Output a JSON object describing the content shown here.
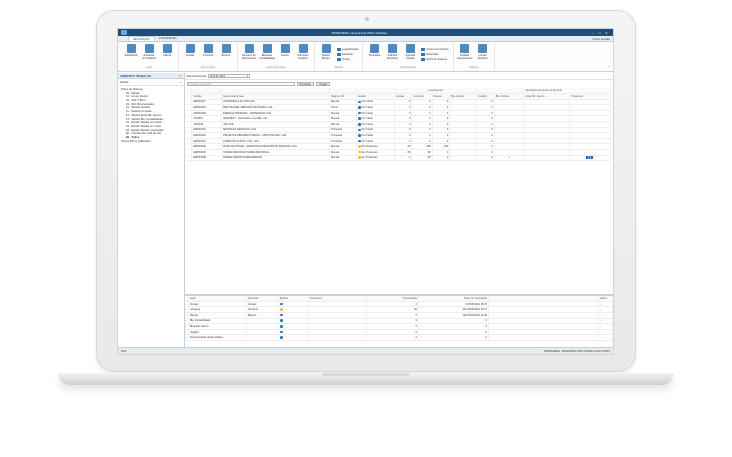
{
  "window": {
    "title": "PRIMAVERA | Accounting Office Software",
    "minimize": "–",
    "maximize": "□",
    "close": "✕"
  },
  "ribbon_tabs": [
    {
      "label": "APLICAÇÃO",
      "active": true
    },
    {
      "label": "CONVERTER",
      "active": false
    }
  ],
  "ribbon_right_link": "Iniciar Sessão",
  "ribbon": {
    "groups": [
      {
        "label": "Início",
        "buttons": [
          {
            "label": "Dashboard",
            "icon": "dashboard-icon",
            "color": "#2e75b6"
          },
          {
            "label": "Ambiente de Trabalho",
            "icon": "workspace-icon",
            "color": "#2e75b6"
          },
          {
            "label": "Cliente",
            "icon": "client-icon",
            "color": "#2e75b6"
          }
        ]
      },
      {
        "label": "Intervenções",
        "buttons": [
          {
            "label": "Vendas",
            "icon": "sales-icon",
            "color": "#2e75b6"
          },
          {
            "label": "Compras",
            "icon": "purchases-icon",
            "color": "#2e75b6"
          },
          {
            "label": "Bancos",
            "icon": "banks-icon",
            "color": "#2e75b6"
          }
        ]
      },
      {
        "label": "Outras Operações",
        "buttons": [
          {
            "label": "Resumo de Documentos",
            "icon": "document-icon",
            "color": "#2e75b6"
          },
          {
            "label": "Bloquear Contabilidade",
            "icon": "lock-icon",
            "color": "#2e75b6"
          },
          {
            "label": "Jasmin",
            "icon": "jasmin-icon",
            "color": "#2e75b6"
          },
          {
            "label": "Submeter Pedidos",
            "icon": "submit-icon",
            "color": "#2e75b6"
          }
        ]
      },
      {
        "label": "Tabelas",
        "buttons": [
          {
            "label": "Dados Mestre",
            "icon": "master-data-icon",
            "color": "#2e75b6"
          }
        ],
        "small": [
          "Legais/Fiscais",
          "Escritório",
          "Outras"
        ]
      },
      {
        "label": "Configurações",
        "buttons": [
          {
            "label": "Templates",
            "icon": "templates-icon",
            "color": "#2e75b6"
          },
          {
            "label": "Padrões Escritório",
            "icon": "defaults-icon",
            "color": "#2e75b6"
          },
          {
            "label": "Agendar Tarefas",
            "icon": "schedule-icon",
            "color": "#2e75b6"
          }
        ],
        "small": [
          "Grupos de Clientes",
          "Extensões",
          "Perfis do Sistema"
        ]
      },
      {
        "label": "Sistema",
        "buttons": [
          {
            "label": "Analisar Lançamentos",
            "icon": "analyze-icon",
            "color": "#2e75b6"
          },
          {
            "label": "Limpar Histórico",
            "icon": "clear-history-icon",
            "color": "#2e75b6"
          }
        ]
      }
    ],
    "collapse": "^"
  },
  "sidebar": {
    "header": "AMBIENTE TRABALHO",
    "close": "✕",
    "subheader": "Pastas",
    "sub_close": "«",
    "items": [
      {
        "label": "Filtros de Sistema",
        "root": true,
        "bold": false
      },
      {
        "label": "00 - Alertas",
        "root": false,
        "bold": false
      },
      {
        "label": "01 - Grupo Jasmin",
        "root": false,
        "bold": false
      },
      {
        "label": "02 - SAF-T Bom",
        "root": false,
        "bold": false
      },
      {
        "label": "03 - IRC Movimentados",
        "root": false,
        "bold": false
      },
      {
        "label": "10 - Tarefas Vendas",
        "root": false,
        "bold": false
      },
      {
        "label": "11 - Tarefas Compras",
        "root": false,
        "bold": false
      },
      {
        "label": "12 - Tarefas Atual.SR. Jasmin",
        "root": false,
        "bold": false
      },
      {
        "label": "13 - Tarefas Blq. Contabilidade",
        "root": false,
        "bold": false
      },
      {
        "label": "20 - Estado Tarefas por iniciar",
        "root": false,
        "bold": false
      },
      {
        "label": "21 - Estado Tarefas em curso",
        "root": false,
        "bold": false
      },
      {
        "label": "22 - Estado Tarefas Concluídas",
        "root": false,
        "bold": false
      },
      {
        "label": "90 - Clientes Sem NIF de IVA",
        "root": false,
        "bold": false
      },
      {
        "label": "99 - Todos",
        "root": false,
        "bold": true
      },
      {
        "label": "Outros Filtros (Utilizador)",
        "root": true,
        "bold": false
      }
    ]
  },
  "content": {
    "period_label": "Mês Referência",
    "period_value": "abril de 2021",
    "search_placeholder": "Pesquisa avançada",
    "search_button": "Pesquisar",
    "clear_button": "Apagar"
  },
  "grid1": {
    "group_headers": {
      "lancamentos": "Lançamentos",
      "operacoes": "Operações de Fecho de Período"
    },
    "columns": [
      "Código",
      "Nome da Empresa",
      "Regime IVA",
      "Estado",
      "Vendas",
      "Compras",
      "Bancos",
      "Blq. Jasmin",
      "Insights",
      "Blq. Contab.",
      "Atual.SR. Jasmin",
      "Progresso"
    ],
    "rows": [
      {
        "code": "EMP00017",
        "name": "A MORDIDA & FILHOS LDA",
        "regime": "Mensal",
        "state": "Por Iniciar",
        "state_color": "#2e75b6",
        "vendas": "0",
        "compras": "0",
        "bancos": "0",
        "blq_jasmin": "",
        "insights": "0",
        "blq_contab": "",
        "atual": "",
        "progress": false
      },
      {
        "code": "EMP00003",
        "name": "DENTISAÚDE, MEDICINA DENTÁRIA, LDA.",
        "regime": "Isento",
        "state": "Por Iniciar",
        "state_color": "#2e75b6",
        "vendas": "0",
        "compras": "0",
        "bancos": "0",
        "blq_jasmin": "",
        "insights": "0",
        "blq_contab": "",
        "atual": "",
        "progress": false
      },
      {
        "code": "EMP00009",
        "name": "ENERGIA TERMOSO - UNIPESSOAL LDA.",
        "regime": "Mensal",
        "state": "Por Iniciar",
        "state_color": "#2e75b6",
        "vendas": "0",
        "compras": "0",
        "bancos": "0",
        "blq_jasmin": "",
        "insights": "0",
        "blq_contab": "",
        "atual": "",
        "progress": false
      },
      {
        "code": "JASMIN",
        "name": "INFOSEGT - Informática e Gestão, Lda.",
        "regime": "Mensal",
        "state": "Por Iniciar",
        "state_color": "#2e75b6",
        "vendas": "0",
        "compras": "0",
        "bancos": "0",
        "blq_jasmin": "",
        "insights": "0",
        "blq_contab": "",
        "atual": "",
        "progress": false
      },
      {
        "code": "JOEJOE",
        "name": "JOE JOE",
        "regime": "Mensal",
        "state": "Por Iniciar",
        "state_color": "#2e75b6",
        "vendas": "0",
        "compras": "0",
        "bancos": "0",
        "blq_jasmin": "",
        "insights": "0",
        "blq_contab": "",
        "atual": "",
        "progress": false
      },
      {
        "code": "EMP00001",
        "name": "METODIUS SERVIÇOS, LDA",
        "regime": "Trimestral",
        "state": "Por Iniciar",
        "state_color": "#2e75b6",
        "vendas": "0",
        "compras": "0",
        "bancos": "0",
        "blq_jasmin": "",
        "insights": "0",
        "blq_contab": "",
        "atual": "",
        "progress": false
      },
      {
        "code": "EMP00004",
        "name": "PROJETOS PERSPECTIVADOS - ARQUITETURA, LDA.",
        "regime": "Trimestral",
        "state": "Por Iniciar",
        "state_color": "#2e75b6",
        "vendas": "0",
        "compras": "0",
        "bancos": "0",
        "blq_jasmin": "",
        "insights": "0",
        "blq_contab": "",
        "atual": "",
        "progress": false
      },
      {
        "code": "EMP00002",
        "name": "ROBSCOP, CONST. CIVIL, LDA.",
        "regime": "Trimestral",
        "state": "Por Iniciar",
        "state_color": "#2e75b6",
        "vendas": "0",
        "compras": "0",
        "bancos": "0",
        "blq_jasmin": "",
        "insights": "0",
        "blq_contab": "",
        "atual": "",
        "progress": false
      },
      {
        "code": "EMP00005",
        "name": "ROCK MOUNTAIN - AVENTURA E DESPORTOS RADICAIS, LDA",
        "regime": "Mensal",
        "state": "Em Progresso",
        "state_color": "#f1c232",
        "vendas": "83",
        "compras": "408",
        "bancos": "182",
        "blq_jasmin": "",
        "insights": "0",
        "blq_contab": "",
        "atual": "",
        "progress": false
      },
      {
        "code": "EMP00006",
        "name": "TRABALHADOR EM NOME INDIVIDUAL",
        "regime": "Mensal",
        "state": "Em Progresso",
        "state_color": "#f1c232",
        "vendas": "83",
        "compras": "68",
        "bancos": "0",
        "blq_jasmin": "",
        "insights": "0",
        "blq_contab": "",
        "atual": "",
        "progress": false
      },
      {
        "code": "EMP00008",
        "name": "TRABALHADOR INDEPENDENTE",
        "regime": "Mensal",
        "state": "Em Progresso",
        "state_color": "#f1c232",
        "vendas": "0",
        "compras": "83",
        "bancos": "0",
        "blq_jasmin": "",
        "insights": "0",
        "blq_contab": "●",
        "atual": "",
        "progress": true
      }
    ]
  },
  "grid2": {
    "columns": [
      "Ação",
      "Extensão",
      "Estado",
      "Pendentes",
      "Processados",
      "Data Ult. Importação",
      "Ações"
    ],
    "rows": [
      {
        "action": "Vendas",
        "ext": "Vendas",
        "dot": "#2e75b6",
        "pend": "",
        "proc": "0",
        "date": "0 05/05/2021 15:15",
        "acts": "..."
      },
      {
        "action": "Compras",
        "ext": "Compras",
        "dot": "#f1c232",
        "pend": "",
        "proc": "60",
        "date": "243 05/05/2021 15:17",
        "acts": "..."
      },
      {
        "action": "Bancos",
        "ext": "Bancos",
        "dot": "#2e75b6",
        "pend": "",
        "proc": "0",
        "date": "198 30/04/2021 10:48",
        "acts": "..."
      },
      {
        "action": "Blq. Contabilidade",
        "ext": "",
        "dot": "#2e75b6",
        "pend": "",
        "proc": "0",
        "date": "0",
        "acts": "..."
      },
      {
        "action": "Bloquear Jasmin",
        "ext": "",
        "dot": "#2e75b6",
        "pend": "",
        "proc": "0",
        "date": "0",
        "acts": "..."
      },
      {
        "action": "Insights",
        "ext": "",
        "dot": "#2e75b6",
        "pend": "",
        "proc": "0",
        "date": "0",
        "acts": "..."
      },
      {
        "action": "Demonstração de Resultados",
        "ext": "",
        "dot": "#2e75b6",
        "pend": "",
        "proc": "0",
        "date": "0",
        "acts": "..."
      }
    ]
  },
  "statusbar": {
    "left": "PAA",
    "right": "PRIMAVERA - BUSINESS SOFTWARE SOLUTIONS"
  }
}
